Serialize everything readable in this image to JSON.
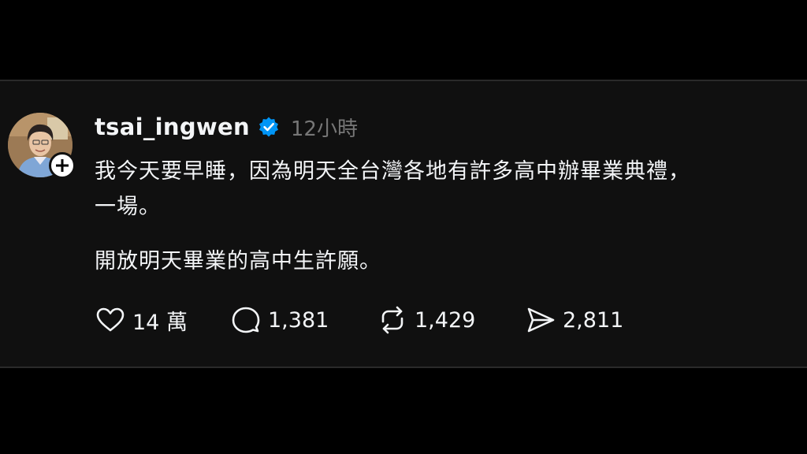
{
  "post": {
    "username": "tsai_ingwen",
    "time": "12小時",
    "lines": [
      "我今天要早睡，因為明天全台灣各地有許多高中辦畢業典禮，",
      "一場。",
      "開放明天畢業的高中生許願。"
    ]
  },
  "actions": {
    "likes": "14 萬",
    "comments": "1,381",
    "reposts": "1,429",
    "shares": "2,811"
  },
  "icons": {
    "verified": "verified-badge-icon",
    "follow": "plus-icon",
    "like": "heart-icon",
    "comment": "comment-bubble-icon",
    "repost": "repost-icon",
    "share": "send-icon"
  },
  "colors": {
    "verified": "#0095f6",
    "text": "#f3f5f7",
    "muted": "#777777",
    "card_bg": "#101010"
  }
}
